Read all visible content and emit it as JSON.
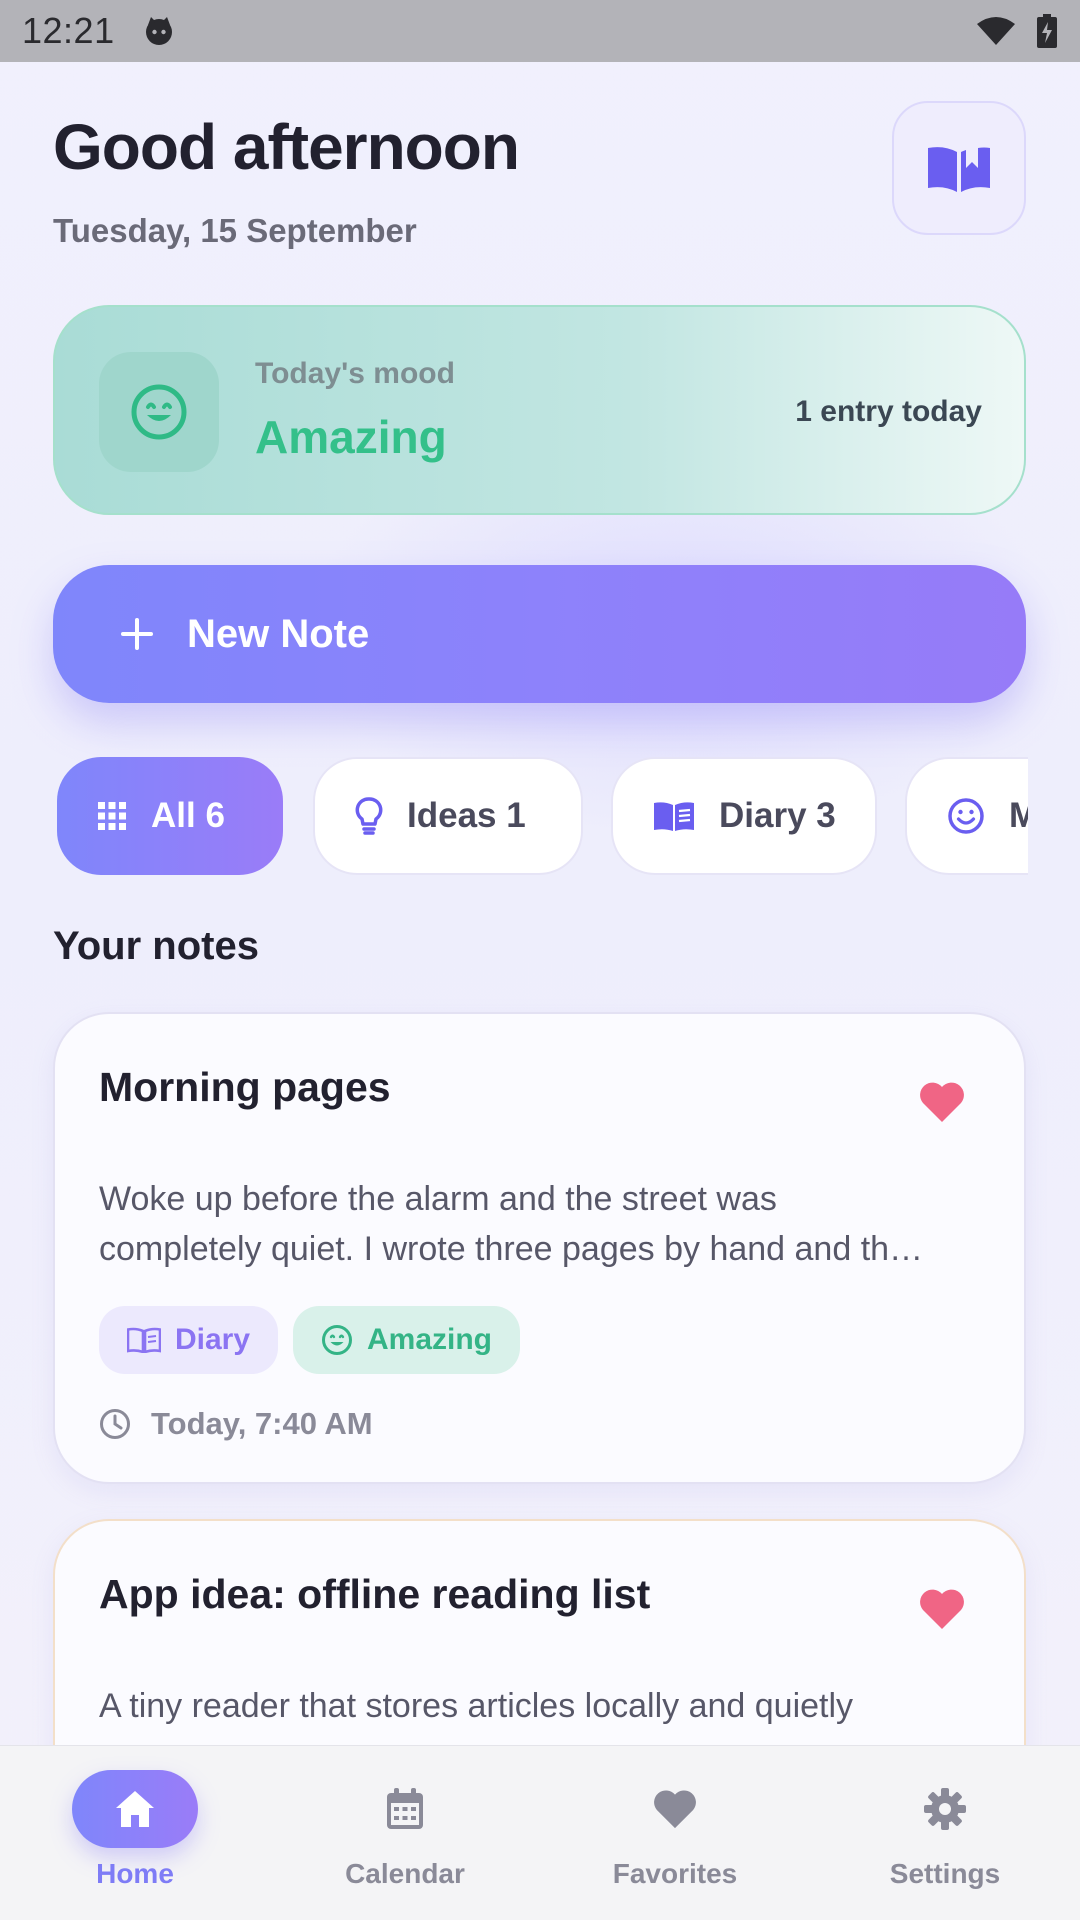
{
  "status_bar": {
    "time": "12:21"
  },
  "header": {
    "greeting": "Good afternoon",
    "date": "Tuesday, 15 September"
  },
  "mood": {
    "label": "Today's mood",
    "value": "Amazing",
    "count": "1 entry today"
  },
  "new_note": {
    "label": "New Note"
  },
  "filters": [
    {
      "label": "All 6",
      "icon": "grid-icon",
      "active": true
    },
    {
      "label": "Ideas 1",
      "icon": "lightbulb-icon",
      "active": false
    },
    {
      "label": "Diary 3",
      "icon": "book-icon",
      "active": false
    },
    {
      "label": "M",
      "icon": "smiley-icon",
      "active": false
    }
  ],
  "section_title": "Your notes",
  "notes": [
    {
      "title": "Morning pages",
      "favorite": true,
      "body_line1": "Woke up before the alarm and the street was",
      "body_line2": "completely quiet. I wrote three pages by hand and th…",
      "category": "Diary",
      "mood": "Amazing",
      "time": "Today, 7:40 AM"
    },
    {
      "title": "App idea: offline reading list",
      "favorite": true,
      "body_line1": "A tiny reader that stores articles locally and quietly"
    }
  ],
  "nav": [
    {
      "label": "Home",
      "icon": "home-icon",
      "active": true
    },
    {
      "label": "Calendar",
      "icon": "calendar-icon",
      "active": false
    },
    {
      "label": "Favorites",
      "icon": "heart-icon",
      "active": false
    },
    {
      "label": "Settings",
      "icon": "gear-icon",
      "active": false
    }
  ],
  "colors": {
    "accent": "#7f86fb",
    "accent_end": "#9a7cf8",
    "mood_green": "#34c08a",
    "favorite_pink": "#f06585"
  }
}
